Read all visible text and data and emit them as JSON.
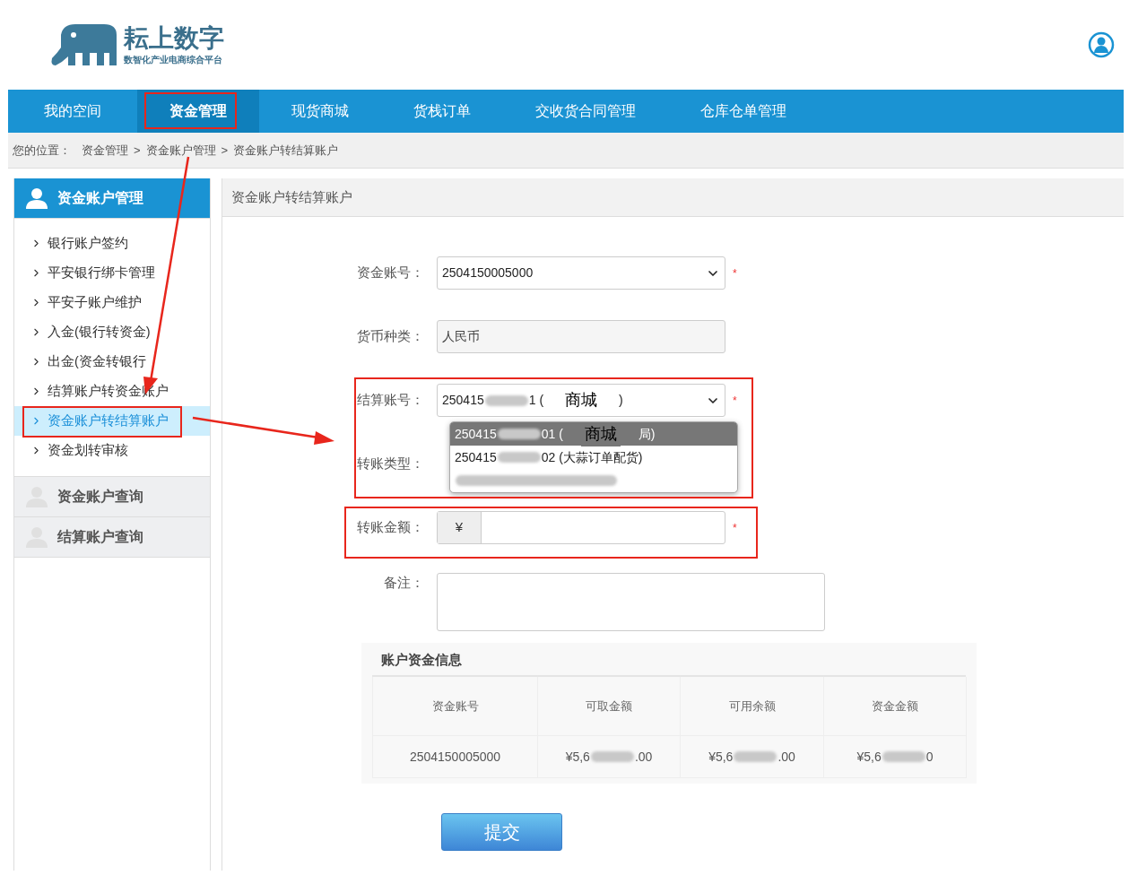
{
  "logo": {
    "title": "耘上数字",
    "subtitle": "数智化产业电商综合平台"
  },
  "nav": [
    {
      "label": "我的空间",
      "selected": false
    },
    {
      "label": "资金管理",
      "selected": true
    },
    {
      "label": "现货商城",
      "selected": false
    },
    {
      "label": "货栈订单",
      "selected": false
    },
    {
      "label": "交收货合同管理",
      "selected": false
    },
    {
      "label": "仓库仓单管理",
      "selected": false
    }
  ],
  "breadcrumb": {
    "prefix": "您的位置：",
    "separator": ">",
    "items": [
      "资金管理",
      "资金账户管理",
      "资金账户转结算账户"
    ]
  },
  "sidebar": [
    {
      "title": "资金账户管理",
      "expanded": true,
      "items": [
        {
          "label": "银行账户签约",
          "selected": false
        },
        {
          "label": "平安银行绑卡管理",
          "selected": false
        },
        {
          "label": "平安子账户维护",
          "selected": false
        },
        {
          "label": "入金(银行转资金)",
          "selected": false
        },
        {
          "label": "出金(资金转银行",
          "selected": false
        },
        {
          "label": "结算账户转资金账户",
          "selected": false
        },
        {
          "label": "资金账户转结算账户",
          "selected": true
        },
        {
          "label": "资金划转审核",
          "selected": false
        }
      ]
    },
    {
      "title": "资金账户查询",
      "expanded": false
    },
    {
      "title": "结算账户查询",
      "expanded": false
    }
  ],
  "panel_title": "资金账户转结算账户",
  "form": [
    {
      "kind": "select",
      "label": "资金账号：",
      "parts": [
        {
          "kind": "text",
          "text": "2504150005000"
        }
      ],
      "required_mark": "*"
    },
    {
      "kind": "readonly",
      "label": "货币种类：",
      "parts": [
        {
          "kind": "text",
          "text": "人民币"
        }
      ]
    },
    {
      "kind": "select",
      "label": "结算账号：",
      "parts": [
        {
          "kind": "text",
          "text": "250415"
        },
        {
          "kind": "blur"
        },
        {
          "kind": "text",
          "text": "1 ("
        },
        {
          "kind": "overlay",
          "text": "商城"
        },
        {
          "kind": "text",
          "text": ")"
        }
      ],
      "required_mark": "*"
    },
    {
      "kind": "covered",
      "label": "转账类型："
    },
    {
      "kind": "currency",
      "label": "转账金额：",
      "prefix": "¥",
      "required_mark": "*"
    },
    {
      "kind": "textarea",
      "label": "备注："
    }
  ],
  "dropdown": [
    {
      "selected": true,
      "parts": [
        {
          "kind": "text",
          "text": "250415"
        },
        {
          "kind": "blur"
        },
        {
          "kind": "text",
          "text": "01 ("
        },
        {
          "kind": "overlay",
          "text": "商城"
        },
        {
          "kind": "text",
          "text": "局)"
        }
      ]
    },
    {
      "selected": false,
      "parts": [
        {
          "kind": "text",
          "text": "250415"
        },
        {
          "kind": "blur"
        },
        {
          "kind": "text",
          "text": "02 (大蒜订单配货)"
        }
      ]
    },
    {
      "selected": false,
      "parts": [
        {
          "kind": "blur"
        }
      ]
    }
  ],
  "info": {
    "title": "账户资金信息",
    "columns": [
      "资金账号",
      "可取金额",
      "可用余额",
      "资金金额"
    ],
    "rows": [
      [
        [
          {
            "kind": "text",
            "text": "2504150005000"
          }
        ],
        [
          {
            "kind": "text",
            "text": "¥5,6"
          },
          {
            "kind": "blur"
          },
          {
            "kind": "text",
            "text": ".00"
          }
        ],
        [
          {
            "kind": "text",
            "text": "¥5,6"
          },
          {
            "kind": "blur"
          },
          {
            "kind": "text",
            "text": ".00"
          }
        ],
        [
          {
            "kind": "text",
            "text": "¥5,6"
          },
          {
            "kind": "blur"
          },
          {
            "kind": "text",
            "text": "0"
          }
        ]
      ]
    ]
  },
  "submit": "提交"
}
